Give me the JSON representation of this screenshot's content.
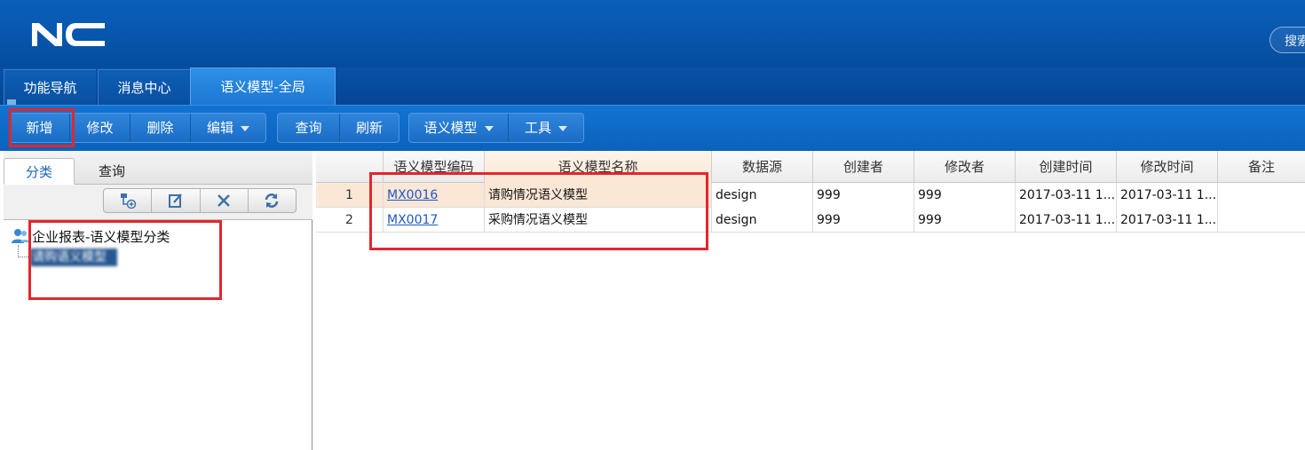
{
  "header": {
    "logo_text": "NC",
    "search_label": "搜索"
  },
  "tabs": [
    {
      "label": "功能导航"
    },
    {
      "label": "消息中心"
    },
    {
      "label": "语义模型-全局"
    }
  ],
  "toolbar": {
    "group1": [
      "新增",
      "修改",
      "删除",
      "编辑"
    ],
    "group2": [
      "查询",
      "刷新"
    ],
    "group3": [
      "语义模型",
      "工具"
    ]
  },
  "left_panel": {
    "tabs": [
      "分类",
      "查询"
    ],
    "tools": [
      "add-node-icon",
      "edit-icon",
      "delete-icon",
      "refresh-icon"
    ],
    "tree_root": "企业报表-语义模型分类",
    "tree_child": "请购语义模型"
  },
  "grid": {
    "columns": [
      "",
      "语义模型编码",
      "语义模型名称",
      "数据源",
      "创建者",
      "修改者",
      "创建时间",
      "修改时间",
      "备注"
    ],
    "rows": [
      [
        "1",
        "MX0016",
        "请购情况语义模型",
        "design",
        "999",
        "999",
        "2017-03-11 1...",
        "2017-03-11 1...",
        ""
      ],
      [
        "2",
        "MX0017",
        "采购情况语义模型",
        "design",
        "999",
        "999",
        "2017-03-11 1...",
        "2017-03-11 1...",
        ""
      ]
    ]
  },
  "colors": {
    "header_blue": "#0756ad",
    "active_tab": "#1d78d2",
    "highlight_box": "#e3262d",
    "selected_row": "#fbe7d5",
    "link": "#1d56c9"
  }
}
